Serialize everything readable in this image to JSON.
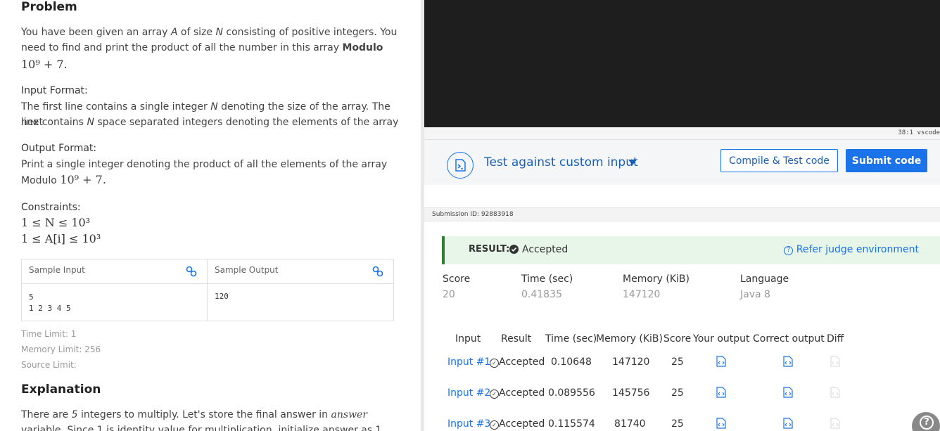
{
  "problem": {
    "title": "Problem",
    "statement_parts": [
      "You have been given an array ",
      "A",
      " of size ",
      "N",
      " consisting of positive integers. You need to find and print the product of all the number in this array ",
      "Modulo"
    ],
    "statement_math": "10⁹ + 7.",
    "input_format_label": "Input Format",
    "input_format_line1_a": "The first line contains a single integer ",
    "input_format_line1_b": "N",
    "input_format_line1_c": " denoting the size of the array. The next",
    "input_format_line2_a": "line contains ",
    "input_format_line2_b": "N",
    "input_format_line2_c": " space separated integers denoting the elements of the array",
    "output_format_label": "Output Format",
    "output_format_line1": "Print a single integer denoting the product of all the elements of the array",
    "output_format_line2_a": "Modulo ",
    "output_format_line2_b": "10⁹ + 7.",
    "constraints_label": "Constraints",
    "constraint1": "1 ≤ N ≤ 10³",
    "constraint2": "1 ≤ A[i] ≤ 10³",
    "sample_input_label": "Sample Input",
    "sample_output_label": "Sample Output",
    "sample_input": "5\n1 2 3 4 5",
    "sample_output": "120",
    "time_limit": "Time Limit: 1",
    "memory_limit": "Memory Limit: 256",
    "source_limit": "Source Limit:",
    "explanation_title": "Explanation",
    "explanation_line1_a": "There are ",
    "explanation_line1_b": "5",
    "explanation_line1_c": " integers to multiply. Let's store the final answer in ",
    "explanation_line1_d": "answer",
    "explanation_line2": "variable. Since 1 is identity value for multiplication, initialize answer as 1"
  },
  "editor": {
    "status": "38:1  vscode"
  },
  "toolbar": {
    "custom_input_label": "Test against custom input",
    "compile_label": "Compile & Test code",
    "submit_label": "Submit code"
  },
  "submission": {
    "id_text": "Submission ID: 92883918",
    "result_label": "RESULT:",
    "result_value": "Accepted",
    "refer_label": "Refer judge environment",
    "summary_headers": [
      "Score",
      "Time (sec)",
      "Memory (KiB)",
      "Language"
    ],
    "summary_values": [
      "20",
      "0.41835",
      "147120",
      "Java 8"
    ],
    "table_headers": [
      "Input",
      "Result",
      "Time (sec)",
      "Memory (KiB)",
      "Score",
      "Your output",
      "Correct output",
      "Diff"
    ],
    "rows": [
      {
        "input": "Input #1",
        "result": "Accepted",
        "time": "0.10648",
        "memory": "147120",
        "score": "25"
      },
      {
        "input": "Input #2",
        "result": "Accepted",
        "time": "0.089556",
        "memory": "145756",
        "score": "25"
      },
      {
        "input": "Input #3",
        "result": "Accepted",
        "time": "0.115574",
        "memory": "81740",
        "score": "25"
      }
    ]
  },
  "colors": {
    "accent": "#1a73e8",
    "success": "#2e7d32",
    "editor_bg": "#1e1e1e"
  }
}
